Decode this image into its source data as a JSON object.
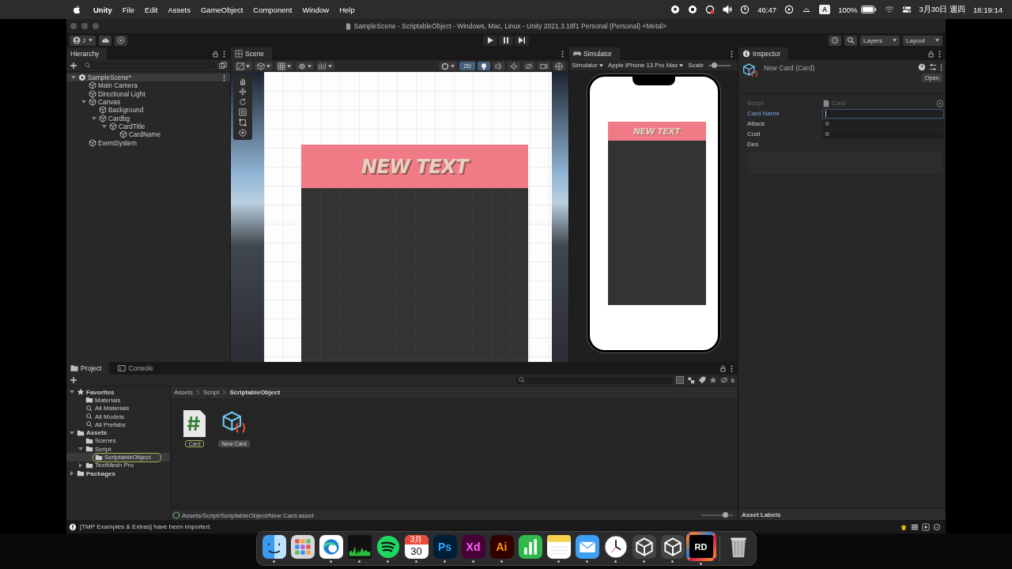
{
  "menu_bar": {
    "app": "Unity",
    "items": [
      "File",
      "Edit",
      "Assets",
      "GameObject",
      "Component",
      "Window",
      "Help"
    ],
    "timer": "46:47",
    "input_source": "A",
    "battery": "100%",
    "date": "3月30日 週四",
    "time": "16:19:14"
  },
  "window": {
    "title": "SampleScene - ScriptableObject - Windows, Mac, Linux - Unity 2021.3.18f1 Personal (Personal) <Metal>"
  },
  "toolbar": {
    "account": "J",
    "layers": "Layers",
    "layout": "Layout"
  },
  "hierarchy": {
    "title": "Hierarchy",
    "tree": [
      {
        "label": "SampleScene*",
        "expanded": true,
        "children": [
          {
            "label": "Main Camera"
          },
          {
            "label": "Directional Light"
          },
          {
            "label": "Canvas",
            "expanded": true,
            "children": [
              {
                "label": "Background"
              },
              {
                "label": "Cardbg",
                "expanded": true,
                "children": [
                  {
                    "label": "CardTitle",
                    "expanded": true,
                    "children": [
                      {
                        "label": "CardName"
                      }
                    ]
                  }
                ]
              }
            ]
          },
          {
            "label": "EventSystem"
          }
        ]
      }
    ]
  },
  "scene": {
    "title": "Scene",
    "mode_button": {
      "label": "2D",
      "on": true
    },
    "lighting_on": true,
    "card_text": "NEW TEXT"
  },
  "simulator": {
    "title": "Simulator",
    "view": "Simulator",
    "device": "Apple iPhone 13 Pro Max",
    "scale_label": "Scale",
    "scale": {
      "level": 0.25
    },
    "card_text": "NEW TEXT"
  },
  "inspector": {
    "title": "Inspector",
    "object": "New Card (Card)",
    "open_button": "Open",
    "fields": [
      {
        "kind": "object",
        "label": "Script",
        "value": "Card",
        "disabled": true,
        "focused": false
      },
      {
        "kind": "text",
        "label": "Card Name",
        "disabled": false,
        "focused": true
      },
      {
        "kind": "text",
        "label": "Attack",
        "value": "0",
        "disabled": false,
        "focused": false
      },
      {
        "kind": "text",
        "label": "Cost",
        "value": "0",
        "disabled": false,
        "focused": false
      },
      {
        "kind": "textarea",
        "label": "Des",
        "disabled": false,
        "focused": false
      }
    ],
    "footer": "Asset Labels"
  },
  "project": {
    "tabs": [
      {
        "label": "Project",
        "selected": true
      },
      {
        "label": "Console",
        "selected": false
      }
    ],
    "hidden_count": "6",
    "tree": [
      {
        "label": "Favorites",
        "kind": "favorites",
        "selected": false,
        "expanded": true,
        "children": [
          {
            "label": "Materials",
            "kind": "folder",
            "selected": false
          },
          {
            "label": "All Materials",
            "kind": "search",
            "selected": false
          },
          {
            "label": "All Models",
            "kind": "search",
            "selected": false
          },
          {
            "label": "All Prefabs",
            "kind": "search",
            "selected": false
          }
        ]
      },
      {
        "label": "Assets",
        "kind": "folder",
        "selected": false,
        "expanded": true,
        "children": [
          {
            "label": "Scenes",
            "kind": "folder",
            "selected": false
          },
          {
            "label": "Script",
            "kind": "folder",
            "selected": false,
            "expanded": true,
            "children": [
              {
                "label": "ScriptableObject",
                "kind": "folder",
                "selected": true
              }
            ]
          },
          {
            "label": "TextMesh Pro",
            "kind": "folder",
            "selected": false,
            "expanded": false
          }
        ]
      },
      {
        "label": "Packages",
        "kind": "folder",
        "selected": false,
        "expanded": false
      }
    ],
    "breadcrumb": [
      "Assets",
      "Script",
      "ScriptableObject"
    ],
    "assets": [
      {
        "kind": "script",
        "name": "Card",
        "selected": false,
        "renaming": true
      },
      {
        "kind": "scriptable",
        "name": "New Card",
        "selected": true,
        "renaming": false
      }
    ],
    "path": "Assets/Script/ScriptableObject/New Card.asset",
    "zoom": {
      "level": 0.75
    }
  },
  "status_bar": {
    "message": "[TMP Examples & Extras] have been imported."
  },
  "dock": [
    {
      "kind": "finder",
      "running": true
    },
    {
      "kind": "launchpad",
      "running": false
    },
    {
      "kind": "edge",
      "running": true
    },
    {
      "kind": "monitor",
      "running": true
    },
    {
      "kind": "spotify",
      "running": true
    },
    {
      "kind": "calendar",
      "month": "3月",
      "day": "30",
      "running": true
    },
    {
      "kind": "ps",
      "label": "Ps",
      "running": true
    },
    {
      "kind": "xd",
      "label": "Xd",
      "running": true
    },
    {
      "kind": "ai",
      "label": "Ai",
      "running": true
    },
    {
      "kind": "numbers",
      "running": false
    },
    {
      "kind": "notes",
      "running": true
    },
    {
      "kind": "mail",
      "running": true
    },
    {
      "kind": "clock",
      "running": true
    },
    {
      "kind": "unity",
      "running": true
    },
    {
      "kind": "unity",
      "running": true
    },
    {
      "kind": "rider",
      "label": "RD",
      "running": true
    },
    {
      "kind": "trash",
      "running": false
    }
  ]
}
